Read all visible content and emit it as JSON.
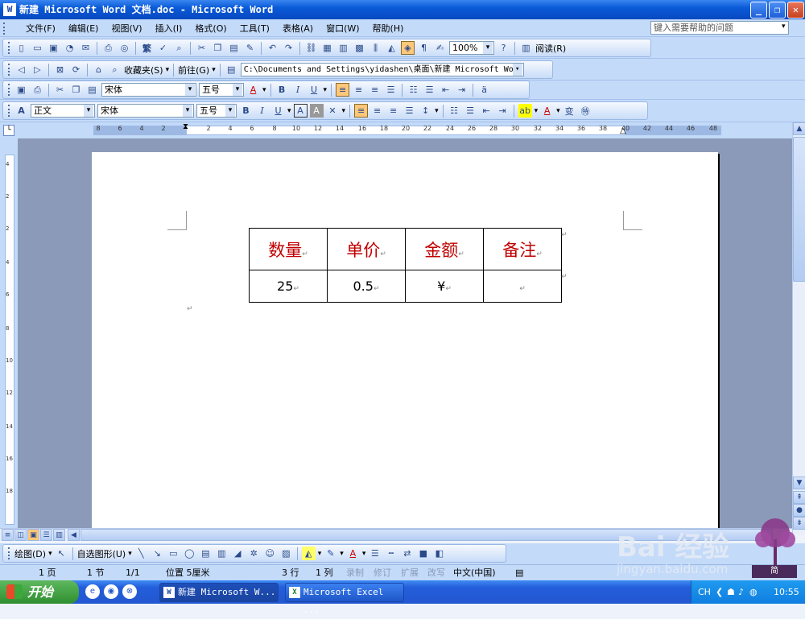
{
  "window": {
    "title": "新建 Microsoft Word 文档.doc - Microsoft Word",
    "minimize": "_",
    "restore": "❐",
    "close": "✕"
  },
  "menu": {
    "items": [
      "文件(F)",
      "编辑(E)",
      "视图(V)",
      "插入(I)",
      "格式(O)",
      "工具(T)",
      "表格(A)",
      "窗口(W)",
      "帮助(H)"
    ],
    "help_placeholder": "键入需要帮助的问题"
  },
  "standard_toolbar": {
    "zoom": "100%",
    "read_label": "阅读(R)"
  },
  "web_toolbar": {
    "favorites": "收藏夹(S)",
    "goto": "前往(G)",
    "address": "C:\\Documents and Settings\\yidashen\\桌面\\新建 Microsoft Wo"
  },
  "format_toolbar_1": {
    "font": "宋体",
    "size": "五号"
  },
  "format_toolbar_2": {
    "style": "正文",
    "font": "宋体",
    "size": "五号"
  },
  "ruler": {
    "labels": [
      "8",
      "6",
      "4",
      "2",
      "2",
      "4",
      "6",
      "8",
      "10",
      "12",
      "14",
      "16",
      "18",
      "20",
      "22",
      "24",
      "26",
      "28",
      "30",
      "32",
      "34",
      "36",
      "38",
      "40",
      "42",
      "44",
      "46",
      "48"
    ],
    "vlabels": [
      "4",
      "2",
      "2",
      "4",
      "6",
      "8",
      "10",
      "12",
      "14",
      "16",
      "18"
    ]
  },
  "document": {
    "table": {
      "headers": [
        "数量",
        "单价",
        "金额",
        "备注"
      ],
      "row": [
        "25",
        "0.5",
        "¥",
        ""
      ]
    },
    "para_mark": "↵"
  },
  "drawing_toolbar": {
    "draw_label": "绘图(D)",
    "autoshapes_label": "自选图形(U)"
  },
  "status_bar": {
    "page": "1 页",
    "section": "1 节",
    "page_of": "1/1",
    "position": "位置 5厘米",
    "line": "3 行",
    "column": "1 列",
    "rec": "录制",
    "trk": "修订",
    "ext": "扩展",
    "ovr": "改写",
    "language": "中文(中国)"
  },
  "taskbar": {
    "start": "开始",
    "tasks": [
      {
        "label": "新建 Microsoft W...",
        "icon": "W"
      },
      {
        "label": "Microsoft Excel ...",
        "icon": "X"
      }
    ],
    "tray_lang": "CH",
    "clock": "10:55"
  },
  "watermark": {
    "logo": "Bai 经验",
    "url": "jingyan.baidu.com",
    "badge": "简"
  }
}
